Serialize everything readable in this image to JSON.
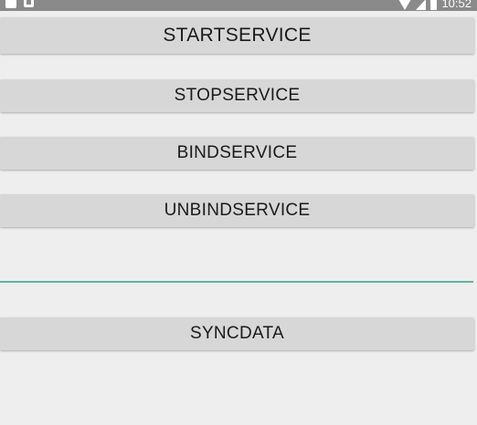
{
  "status_bar": {
    "time": "10:52",
    "icons": [
      "app-notification-icon",
      "a-notification-icon",
      "wifi-icon",
      "cell-signal-icon",
      "battery-icon"
    ]
  },
  "buttons": {
    "start_service": "STARTSERVICE",
    "stop_service": "STOPSERVICE",
    "bind_service": "BINDSERVICE",
    "unbind_service": "UNBINDSERVICE",
    "sync_data": "SYNCDATA"
  },
  "input": {
    "value": "",
    "placeholder": ""
  },
  "colors": {
    "background": "#eeeeee",
    "button": "#d7d7d7",
    "input_underline": "#5fb5a5",
    "status_bar": "#8a8a8a"
  }
}
